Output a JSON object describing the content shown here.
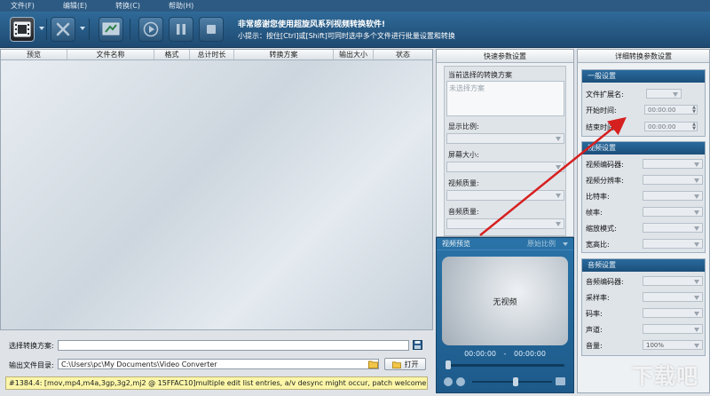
{
  "menu": [
    "文件(F)",
    "编辑(E)",
    "转换(C)",
    "帮助(H)"
  ],
  "banner": {
    "title": "非常感谢您使用超旋风系列视频转换软件!",
    "tip": "小提示：按住[Ctrl]或[Shift]可同时选中多个文件进行批量设置和转换"
  },
  "file_list": {
    "columns": [
      "预览",
      "文件名称",
      "格式",
      "总计时长",
      "转换方案",
      "输出大小",
      "状态"
    ]
  },
  "bottom": {
    "scheme_label": "选择转换方案:",
    "scheme_value": "",
    "output_label": "输出文件目录:",
    "output_path": "C:\\Users\\pc\\My Documents\\Video Converter",
    "open_label": "打开",
    "log": "#1384.4: [mov,mp4,m4a,3gp,3g2,mj2 @ 15FFAC10]multiple edit list entries, a/v desync might occur, patch welcome"
  },
  "quick": {
    "title": "快速参数设置",
    "current_scheme_label": "当前选择的转换方案",
    "scheme_placeholder": "未选择方案",
    "display_ratio": "显示比例:",
    "screen_size": "屏幕大小:",
    "video_quality": "视频质量:",
    "audio_quality": "音频质量:"
  },
  "preview": {
    "title": "视频预览",
    "ratio_label": "原始比例",
    "no_video": "无视频",
    "time_current": "00:00:00",
    "time_separator": "-",
    "time_total": "00:00:00"
  },
  "detail": {
    "title": "详细转换参数设置",
    "general": {
      "title": "一般设置",
      "ext_label": "文件扩展名:",
      "start_label": "开始时间:",
      "start_value": "00:00:00",
      "end_label": "结束时间:",
      "end_value": "00:00:00"
    },
    "video": {
      "title": "视频设置",
      "encoder": "视频编码器:",
      "resolution": "视频分辨率:",
      "bitrate": "比特率:",
      "framerate": "帧率:",
      "scale_mode": "缩放模式:",
      "aspect": "宽高比:"
    },
    "audio": {
      "title": "音频设置",
      "encoder": "音频编码器:",
      "samplerate": "采样率:",
      "bitrate": "码率:",
      "channels": "声道:",
      "volume": "音量:",
      "volume_value": "100%"
    }
  },
  "watermark": "下载吧",
  "colors": {
    "toolbar": "#1e4a72",
    "accent": "#2a73a8",
    "arrow": "#d62020",
    "log_bg": "#fbf6a8"
  }
}
